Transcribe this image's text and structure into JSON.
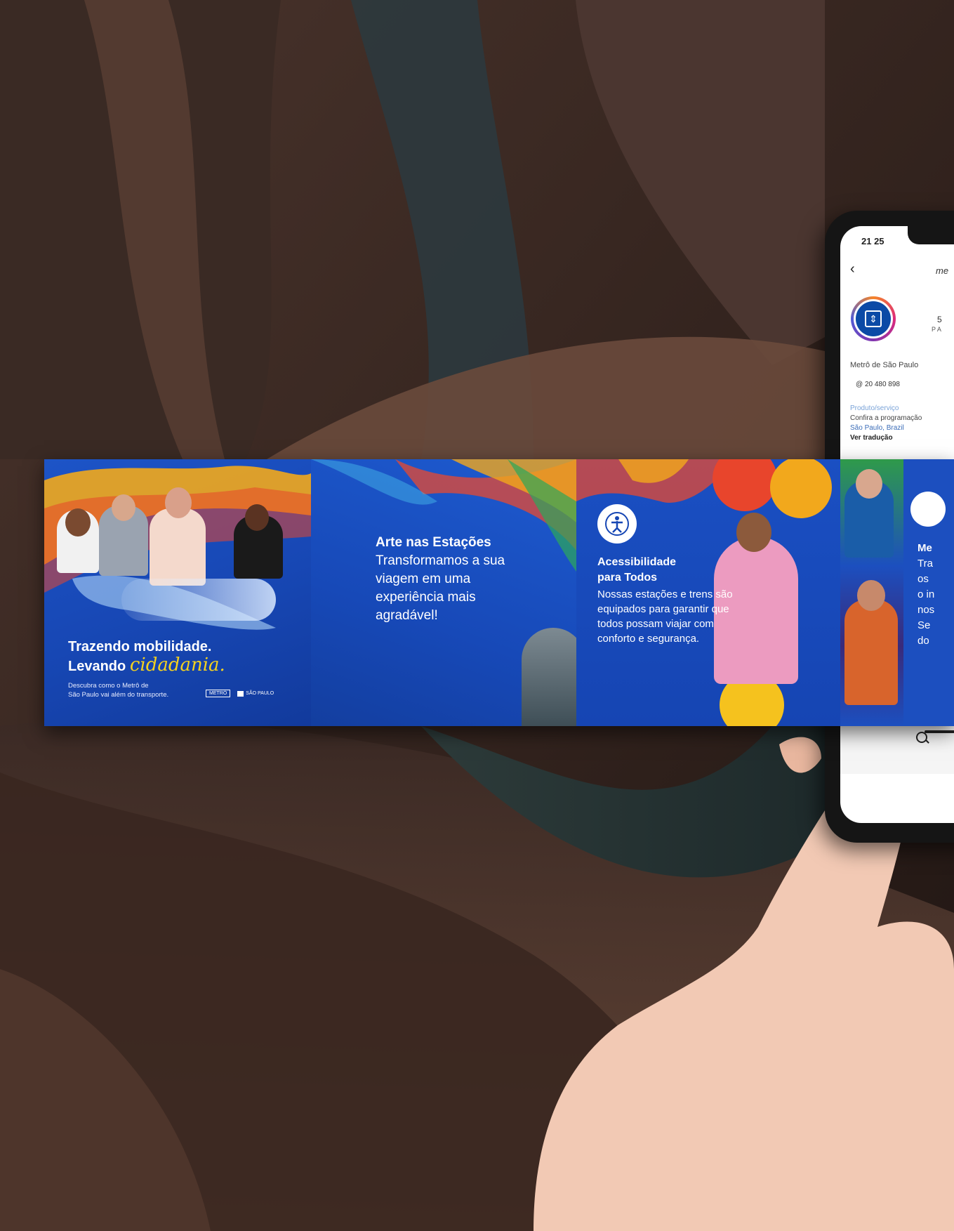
{
  "phone": {
    "time": "21 25",
    "handle": "me",
    "stat": "5",
    "stat_sub": "P A",
    "profile_name": "Metrô de São Paulo",
    "threads": "20 480 898",
    "category": "Produto/serviço",
    "bio": "Confira a programação",
    "location": "São Paulo, Brazil",
    "see_translation": "Ver tradução"
  },
  "brochure": {
    "panel1": {
      "headline_line1": "Trazendo mobilidade.",
      "headline_line2_prefix": "Levando",
      "headline_line2_accent": "cidadania.",
      "subtext_line1": "Descubra como o Metrô de",
      "subtext_line2": "São Paulo vai além do transporte.",
      "logo_metro": "METRÔ",
      "logo_sp": "SÃO PAULO"
    },
    "panel2": {
      "title": "Arte nas Estações",
      "text": "Transformamos a sua viagem em uma experiência mais agradável!"
    },
    "panel3": {
      "title_line1": "Acessibilidade",
      "title_line2": "para Todos",
      "text": "Nossas estações e trens são equipados para garantir que todos possam viajar com conforto e segurança."
    },
    "panel4": {
      "line1": "Me",
      "line2": "Tra",
      "line3": "os",
      "line4": "o in",
      "line5": "nos",
      "line6": "Se",
      "line7": "do"
    }
  },
  "colors": {
    "brochure_blue": "#1747b4",
    "accent_yellow": "#f5d21e",
    "background_brown": "#2a1c17"
  }
}
